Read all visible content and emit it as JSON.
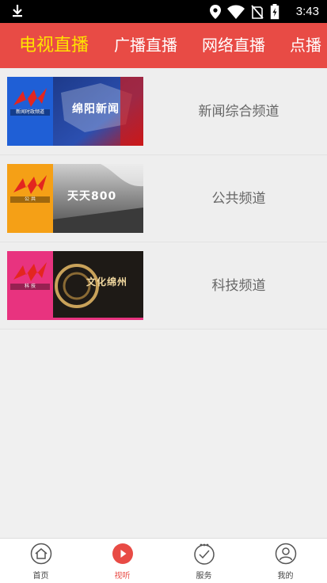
{
  "status_bar": {
    "time": "3:43",
    "icons": [
      "download-icon",
      "location-icon",
      "wifi-icon",
      "no-sim-icon",
      "battery-charging-icon"
    ]
  },
  "tabs": [
    {
      "label": "电视直播",
      "active": true
    },
    {
      "label": "广播直播",
      "active": false
    },
    {
      "label": "网络直播",
      "active": false
    },
    {
      "label": "点播",
      "active": false
    }
  ],
  "channels": [
    {
      "name": "新闻综合频道",
      "logo_caption": "新闻时政频道",
      "scene_text": "绵阳新闻",
      "accent": "#1f5fd6"
    },
    {
      "name": "公共频道",
      "logo_caption": "公 共",
      "scene_text": "天天800",
      "accent": "#f5a016"
    },
    {
      "name": "科技频道",
      "logo_caption": "科 技",
      "scene_text": "文化绵州",
      "accent": "#e8337f"
    }
  ],
  "bottom_nav": [
    {
      "label": "首页",
      "icon": "home-icon",
      "active": false
    },
    {
      "label": "视听",
      "icon": "play-circle-icon",
      "active": true
    },
    {
      "label": "服务",
      "icon": "service-icon",
      "active": false
    },
    {
      "label": "我的",
      "icon": "user-icon",
      "active": false
    }
  ],
  "colors": {
    "brand": "#e84b45",
    "active_tab": "#ffe300"
  }
}
